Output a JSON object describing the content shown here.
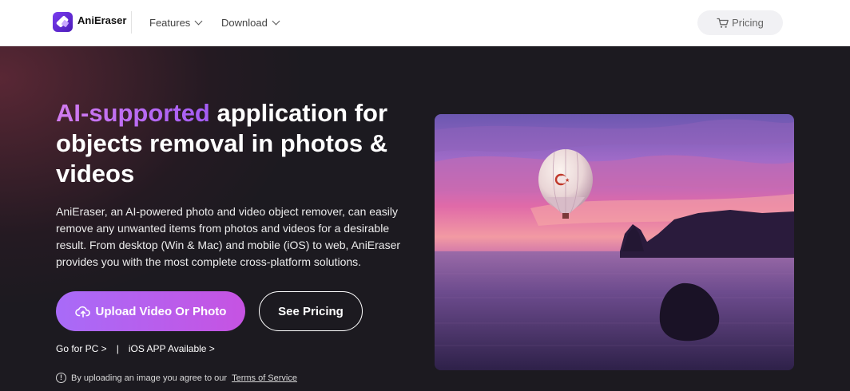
{
  "nav": {
    "brand": "AniEraser",
    "items": [
      {
        "label": "Features"
      },
      {
        "label": "Download"
      }
    ],
    "pricing_label": "Pricing"
  },
  "hero": {
    "title_accent": "AI-supported",
    "title_rest": " application for objects removal in photos & videos",
    "description": "AniEraser, an AI-powered photo and video object remover, can easily remove any unwanted items from photos and videos for a desirable result. From desktop (Win & Mac) and mobile (iOS) to web, AniEraser provides you with the most complete cross-platform solutions.",
    "upload_label": "Upload Video Or Photo",
    "see_pricing_label": "See Pricing",
    "link_pc": "Go for PC >",
    "link_sep": "|",
    "link_ios": "iOS APP Available >",
    "terms_prefix": "By uploading an image you agree to our",
    "terms_link": "Terms of Service"
  },
  "icons": {
    "logo": "aniEraser-logo-icon",
    "cart": "cart-icon",
    "upload": "cloud-upload-icon",
    "info": "info-icon",
    "chevron": "chevron-down-icon"
  },
  "colors": {
    "accent_gradient_start": "#a86bf8",
    "accent_gradient_end": "#c653e2",
    "title_accent": "#c576f0",
    "hero_bg": "#1c1a20"
  }
}
